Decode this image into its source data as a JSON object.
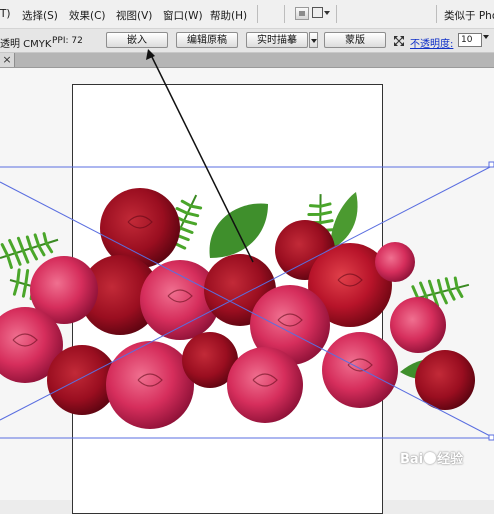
{
  "menubar": {
    "items": [
      "T)",
      "选择(S)",
      "效果(C)",
      "视图(V)",
      "窗口(W)",
      "帮助(H)"
    ],
    "right_text": "类似于 Pho"
  },
  "optbar": {
    "label_left": "透明 CMYK",
    "ppi": "PPI: 72",
    "buttons": {
      "embed": "嵌入",
      "edit_original": "编辑原稿",
      "live_trace": "实时描摹",
      "mask": "蒙版"
    },
    "opacity_label": "不透明度:",
    "opacity_value": "10"
  },
  "tab": {
    "close": "×"
  },
  "watermark": {
    "text_1": "Bai",
    "text_2": "经验"
  },
  "colors": {
    "guide": "#5a6ee0",
    "link": "#1030c8"
  }
}
